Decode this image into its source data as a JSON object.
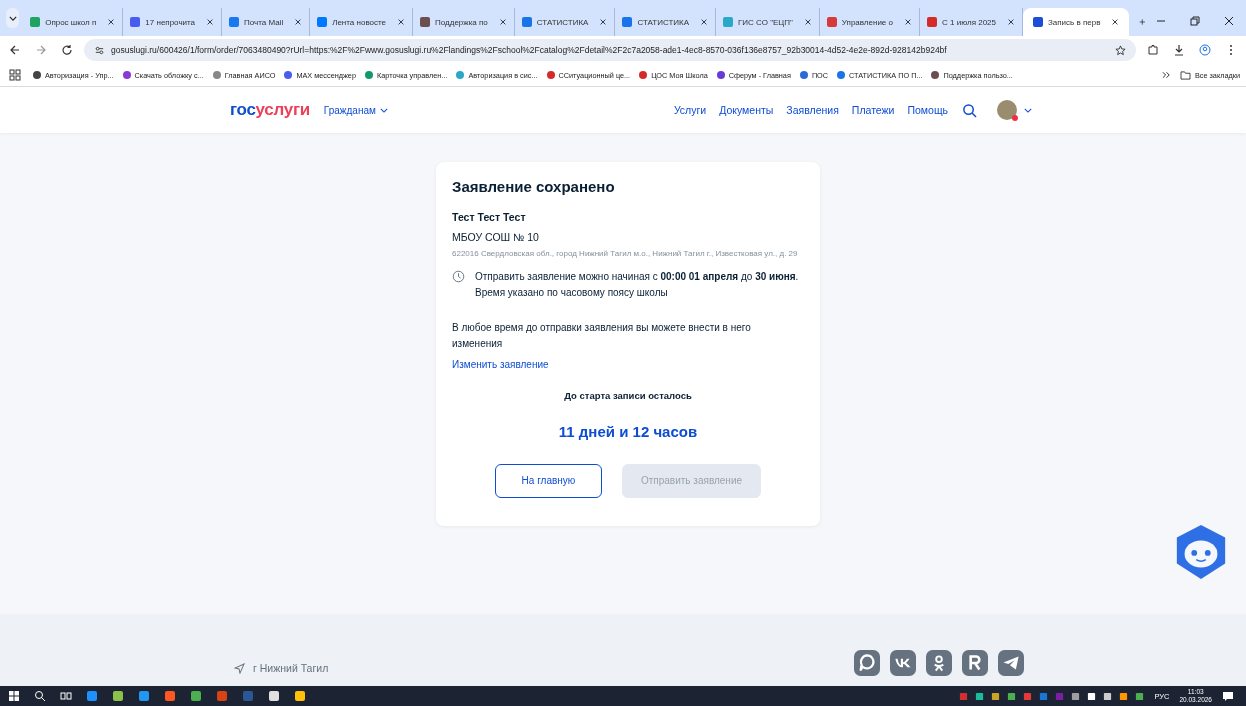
{
  "browser": {
    "tabs": [
      {
        "title": "Опрос школ п",
        "selected": false,
        "color": "#1ea362"
      },
      {
        "title": "17 непрочита",
        "selected": false,
        "color": "#4a5cf0"
      },
      {
        "title": "Почта Mail",
        "selected": false,
        "color": "#1877f2"
      },
      {
        "title": "Лента новосте",
        "selected": false,
        "color": "#0077ff"
      },
      {
        "title": "Поддержка по",
        "selected": false,
        "color": "#6b4f4f"
      },
      {
        "title": "СТАТИСТИКА",
        "selected": false,
        "color": "#1a73e8"
      },
      {
        "title": "СТАТИСТИКА",
        "selected": false,
        "color": "#1a73e8"
      },
      {
        "title": "ГИС СО \"ЕЦП\"",
        "selected": false,
        "color": "#2aa8c8"
      },
      {
        "title": "Управление о",
        "selected": false,
        "color": "#d63a3a"
      },
      {
        "title": "С 1 июля 2025",
        "selected": false,
        "color": "#d42a2a"
      },
      {
        "title": "Запись в перв",
        "selected": true,
        "color": "#1c4fd8"
      }
    ],
    "url": "gosuslugi.ru/600426/1/form/order/7063480490?rUrl=https:%2F%2Fwww.gosuslugi.ru%2Flandings%2Fschool%2Fcatalog%2Fdetail%2F2c7a2058-ade1-4ec8-8570-036f136e8757_92b30014-4d52-4e2e-892d-928142b924bf",
    "bookmarks": [
      {
        "label": "Авторизация - Упр...",
        "color": "#444444"
      },
      {
        "label": "Скачать обложку с...",
        "color": "#8a3ad6"
      },
      {
        "label": "Главная АИСО",
        "color": "#888888"
      },
      {
        "label": "MAX мессенджер",
        "color": "#4a5cf0"
      },
      {
        "label": "Карточка управлен...",
        "color": "#139a6b"
      },
      {
        "label": "Авторизация в сис...",
        "color": "#2aa8c8"
      },
      {
        "label": "ССитуационный це...",
        "color": "#d42a2a"
      },
      {
        "label": "ЦОС Моя Школа",
        "color": "#d42a2a"
      },
      {
        "label": "Сферум - Главная",
        "color": "#6a3ad6"
      },
      {
        "label": "ПОС",
        "color": "#2a6ad6"
      },
      {
        "label": "СТАТИСТИКА ПО П...",
        "color": "#1a73e8"
      },
      {
        "label": "Поддержка пользо...",
        "color": "#6b4f4f"
      }
    ],
    "all_bookmarks": "Все закладки"
  },
  "header": {
    "logo": {
      "part_1": "гос",
      "part_2": "услуги"
    },
    "menu": "Гражданам",
    "nav": [
      "Услуги",
      "Документы",
      "Заявления",
      "Платежи",
      "Помощь"
    ]
  },
  "card": {
    "title": "Заявление сохранено",
    "name": "Тест Тест Тест",
    "school": "МБОУ СОШ № 10",
    "address": "622016 Свердловская обл., город Нижний Тагил м.о., Нижний Тагил г., Известковая ул., д. 29",
    "notice": "Отправить заявление можно начиная с **00:00 01 апреля** до **30 июня**. Время указано по часовому поясу школы",
    "info": "В любое время до отправки заявления вы можете внести в него изменения",
    "edit_link": "Изменить заявление",
    "countdown_label": "До старта записи осталось",
    "countdown": "11 дней и 12 часов",
    "buttons": [
      {
        "label": "На главную",
        "disabled": false
      },
      {
        "label": "Отправить заявление",
        "disabled": true
      }
    ]
  },
  "footer": {
    "city": "г Нижний Тагил"
  },
  "taskbar": {
    "language": "РУС",
    "time": "11:03",
    "date": "20.03.2026"
  }
}
